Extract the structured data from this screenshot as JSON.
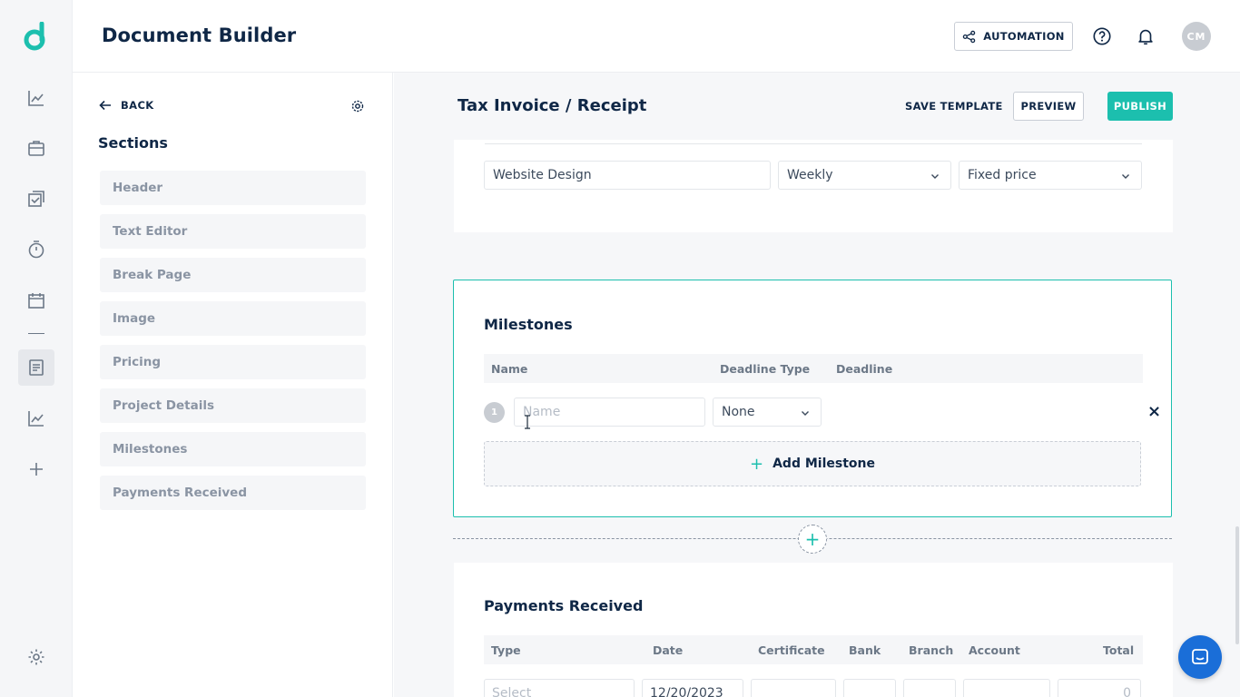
{
  "app": {
    "title": "Document Builder",
    "accent_color": "#1cbfae",
    "automation_label": "AUTOMATION",
    "avatar_initials": "CM"
  },
  "rail": {
    "icons": [
      "logo-icon",
      "analytics-icon",
      "briefcase-icon",
      "checklist-icon",
      "timer-icon",
      "calendar-icon",
      "document-icon",
      "reports-icon",
      "add-icon",
      "settings-icon"
    ],
    "active": "document-icon"
  },
  "panel": {
    "back_label": "BACK",
    "sections_title": "Sections",
    "items": [
      {
        "label": "Header"
      },
      {
        "label": "Text Editor"
      },
      {
        "label": "Break Page"
      },
      {
        "label": "Image"
      },
      {
        "label": "Pricing"
      },
      {
        "label": "Project Details"
      },
      {
        "label": "Milestones"
      },
      {
        "label": "Payments Received"
      }
    ]
  },
  "editor": {
    "doc_title": "Tax Invoice / Receipt",
    "save_template_label": "SAVE TEMPLATE",
    "preview_label": "PREVIEW",
    "publish_label": "PUBLISH",
    "project_row": {
      "name_value": "Website Design",
      "frequency_value": "Weekly",
      "pricing_value": "Fixed price"
    },
    "milestones": {
      "title": "Milestones",
      "columns": [
        "Name",
        "Deadline Type",
        "Deadline"
      ],
      "rows": [
        {
          "number": "1",
          "name_placeholder": "Name",
          "deadline_type": "None"
        }
      ],
      "add_label": "Add Milestone",
      "remove_symbol": "×"
    },
    "payments": {
      "title": "Payments Received",
      "columns": [
        "Type",
        "Date",
        "Certificate",
        "Bank",
        "Branch",
        "Account",
        "Total"
      ],
      "row": {
        "type_placeholder": "Select",
        "date": "12/20/2023",
        "total": "0"
      }
    }
  }
}
